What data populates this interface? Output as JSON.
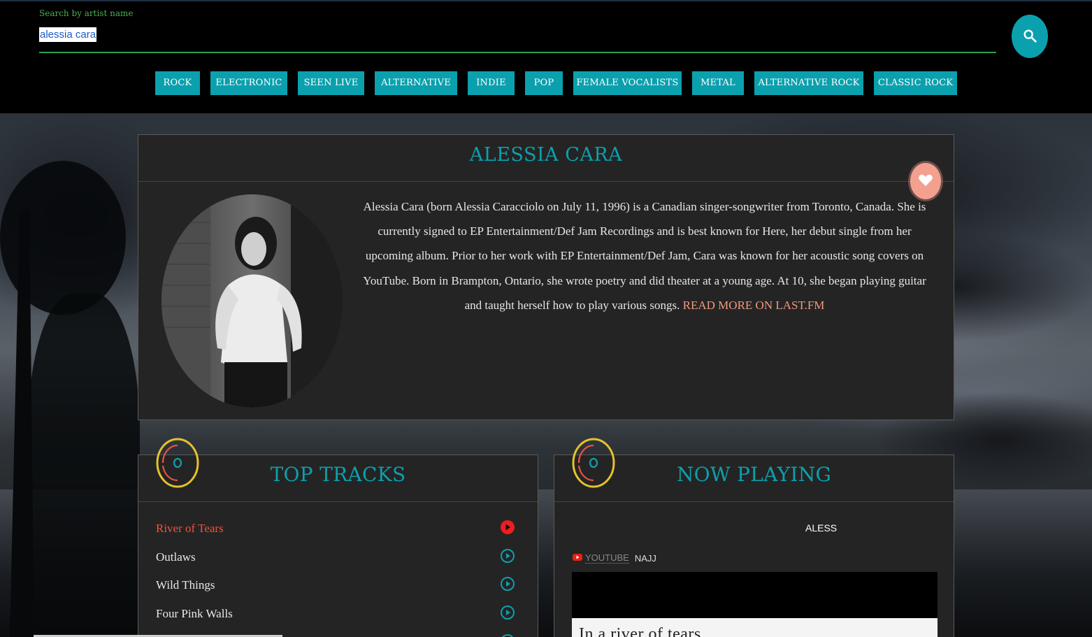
{
  "search": {
    "label": "Search by artist name",
    "value": "alessia cara",
    "button_icon": "search-icon"
  },
  "tags": [
    "ROCK",
    "ELECTRONIC",
    "SEEN LIVE",
    "ALTERNATIVE",
    "INDIE",
    "POP",
    "FEMALE VOCALISTS",
    "METAL",
    "ALTERNATIVE ROCK",
    "CLASSIC ROCK"
  ],
  "artist": {
    "name": "ALESSIA CARA",
    "favorite_icon": "heart-icon",
    "bio": "Alessia Cara (born Alessia Caracciolo on July 11, 1996) is a Canadian singer-songwriter from Toronto, Canada. She is currently signed to EP Entertainment/Def Jam Recordings and is best known for Here, her debut single from her upcoming album. Prior to her work with EP Entertainment/Def Jam, Cara was known for her acoustic song covers on YouTube. Born in Brampton, Ontario, she wrote poetry and did theater at a young age. At 10, she began playing guitar and taught herself how to play various songs.",
    "read_more": "READ MORE ON LAST.FM"
  },
  "top_tracks": {
    "title": "TOP TRACKS",
    "tracks": [
      {
        "name": "River of Tears",
        "active": true
      },
      {
        "name": "Outlaws",
        "active": false
      },
      {
        "name": "Wild Things",
        "active": false
      },
      {
        "name": "Four Pink Walls",
        "active": false
      }
    ]
  },
  "now_playing": {
    "title": "NOW PLAYING",
    "marquee": "ALESSIA CARA",
    "source_label": "YOUTUBE",
    "channel": "NAJJ",
    "video_caption": "In a river of tears"
  },
  "colors": {
    "accent": "#0ba0ad",
    "active_track": "#f0533d",
    "link": "#f39a7c",
    "favorite": "#f4a08f",
    "search_underline": "#2e9e4c"
  }
}
